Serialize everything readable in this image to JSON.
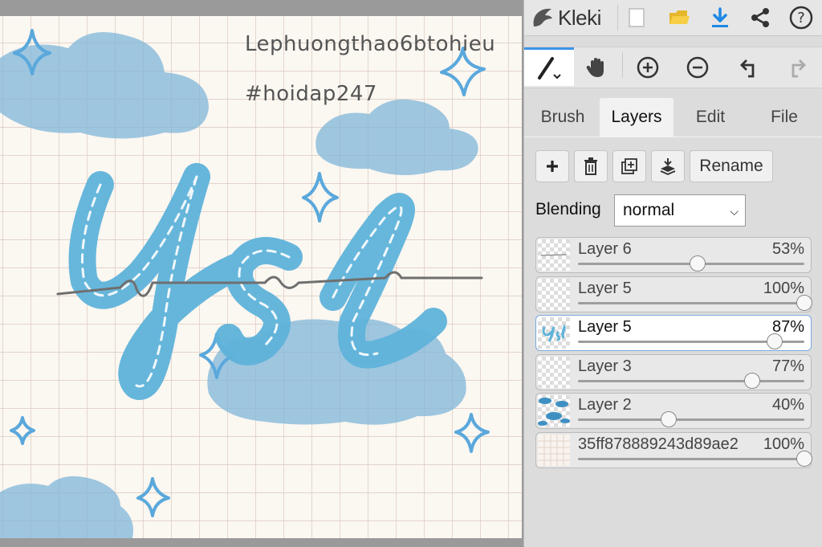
{
  "canvas": {
    "text_line1": "Lephuongthao6btohieu",
    "text_line2": "#hoidap247",
    "artwork_word": "ysl"
  },
  "app": {
    "name": "Kleki",
    "accent_color": "#3e93e8",
    "top_buttons": [
      "new-image-icon",
      "open-folder-icon",
      "download-icon",
      "share-icon",
      "help-icon"
    ]
  },
  "toolbar": {
    "tools": [
      "brush-tool-icon",
      "hand-tool-icon",
      "zoom-in-icon",
      "zoom-out-icon",
      "undo-icon",
      "redo-icon"
    ]
  },
  "tabs": [
    {
      "label": "Brush"
    },
    {
      "label": "Layers"
    },
    {
      "label": "Edit"
    },
    {
      "label": "File"
    }
  ],
  "layers_panel": {
    "rename_label": "Rename",
    "blending_label": "Blending",
    "blending_value": "normal",
    "layers": [
      {
        "name": "Layer 6",
        "opacity": "53%",
        "value": 0.53
      },
      {
        "name": "Layer 5",
        "opacity": "100%",
        "value": 1.0
      },
      {
        "name": "Layer 5",
        "opacity": "87%",
        "value": 0.87
      },
      {
        "name": "Layer 3",
        "opacity": "77%",
        "value": 0.77
      },
      {
        "name": "Layer 2",
        "opacity": "40%",
        "value": 0.4
      },
      {
        "name": "35ff878889243d89ae2",
        "opacity": "100%",
        "value": 1.0
      }
    ]
  }
}
